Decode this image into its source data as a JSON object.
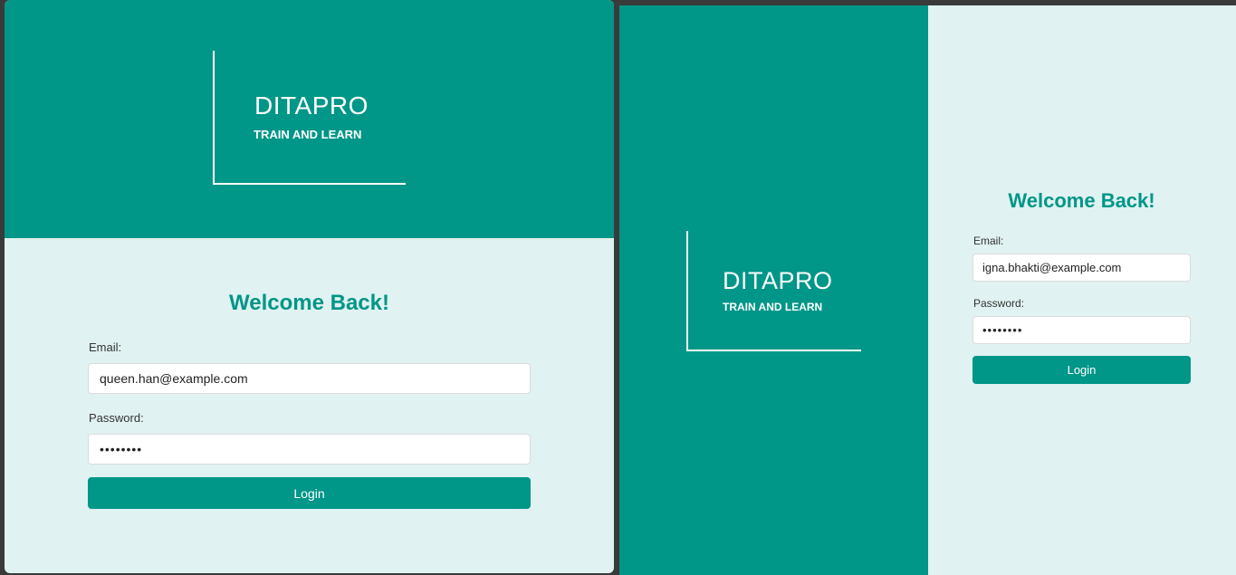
{
  "brand": {
    "name": "DITAPRO",
    "tagline": "TRAIN AND LEARN"
  },
  "colors": {
    "primary": "#009688",
    "form_background": "#e0f2f1",
    "separator": "#3a3a3a"
  },
  "left_view": {
    "heading": "Welcome Back!",
    "email_label": "Email:",
    "email_value": "queen.han@example.com",
    "password_label": "Password:",
    "password_value": "••••••••",
    "login_label": "Login"
  },
  "right_view": {
    "heading": "Welcome Back!",
    "email_label": "Email:",
    "email_value": "igna.bhakti@example.com",
    "password_label": "Password:",
    "password_value": "••••••••",
    "login_label": "Login"
  }
}
